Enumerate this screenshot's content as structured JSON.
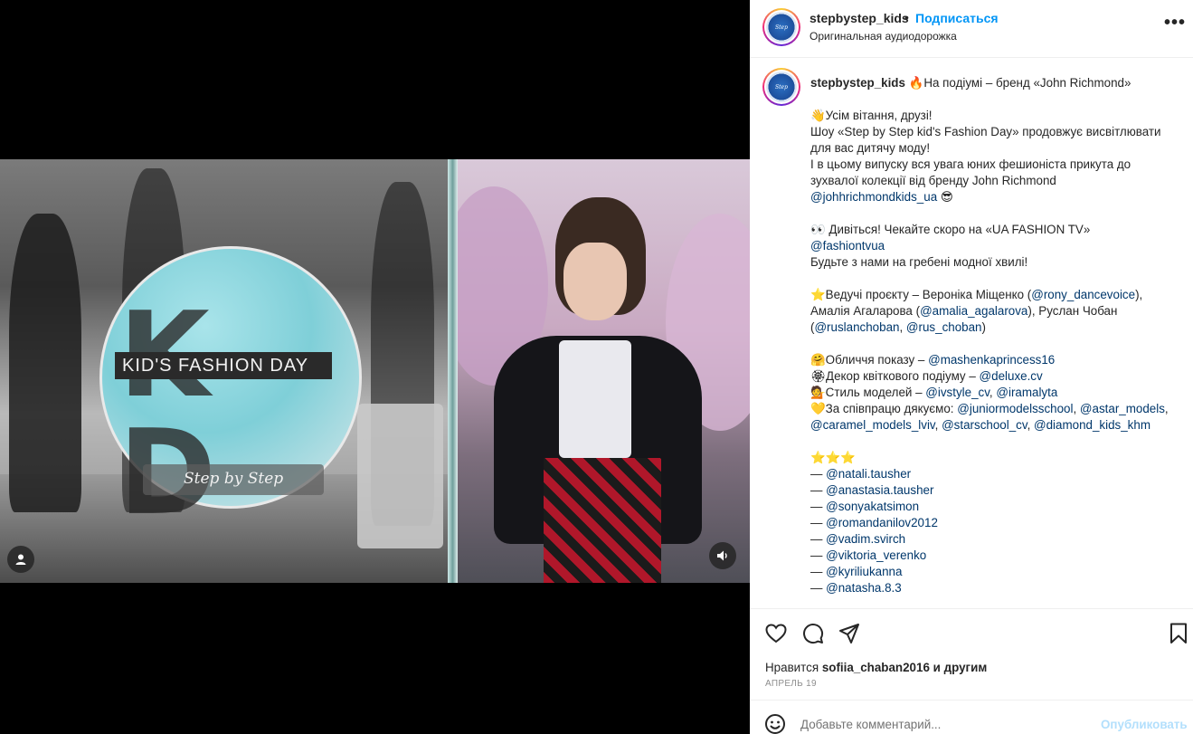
{
  "header": {
    "username": "stepbystep_kids",
    "dot": "•",
    "follow_label": "Подписаться",
    "subtitle": "Оригинальная аудиодорожка",
    "more": "•••"
  },
  "video": {
    "logo_title": "KID'S FASHION DAY",
    "logo_letters": "K-D",
    "logo_subtitle": "Step by Step",
    "user_icon": "user-icon",
    "sound_icon": "speaker-icon"
  },
  "caption": {
    "username": "stepbystep_kids",
    "lines": [
      "🔥На подіумі – бренд «John Richmond»",
      "",
      "👋Усім вітання, друзі!",
      "Шоу «Step by Step kid's Fashion Day» продовжує висвітлювати для вас дитячу моду!",
      "І в цьому випуску вся увага юних фешионіста прикута до зухвалої колекції від бренду John Richmond",
      "@johhrichmondkids_ua 😎",
      "",
      "👀 Дивіться! Чекайте скоро на «UA FASHION TV»",
      "@fashiontvua",
      "Будьте з нами на гребені модної хвилі!",
      "",
      "⭐Ведучі проєкту – Вероніка Міщенко (@rony_dancevoice), Амалія Агаларова (@amalia_agalarova), Руслан Чобан (@ruslanchoban, @rus_choban)",
      "",
      "🤗Обличчя показу – @mashenkaprincess16",
      "🏵Декор квіткового подіуму – @deluxe.cv",
      "💁Стиль моделей – @ivstyle_cv, @iramalyta",
      "💛За співпрацю дякуємо: @juniormodelsschool, @astar_models, @caramel_models_lviv, @starschool_cv, @diamond_kids_khm",
      "",
      "⭐⭐⭐",
      "— @natali.tausher",
      "— @anastasia.tausher",
      "— @sonyakatsimon",
      "— @romandanilov2012",
      "— @vadim.svirch",
      "— @viktoria_verenko",
      "— @kyriliukanna",
      "— @natasha.8.3"
    ]
  },
  "actions": {
    "like_icon": "heart-icon",
    "comment_icon": "comment-icon",
    "share_icon": "send-icon",
    "save_icon": "bookmark-icon",
    "likes_prefix": "Нравится ",
    "likes_user": "sofiia_chaban2016",
    "likes_suffix": " и другим",
    "date": "АПРЕЛЬ 19"
  },
  "comment": {
    "emoji_icon": "smiley-icon",
    "placeholder": "Добавьте комментарий...",
    "publish_label": "Опубликовать"
  },
  "colors": {
    "follow": "#0095f6",
    "mention": "#00376b",
    "publish_disabled": "#b2dffc"
  }
}
